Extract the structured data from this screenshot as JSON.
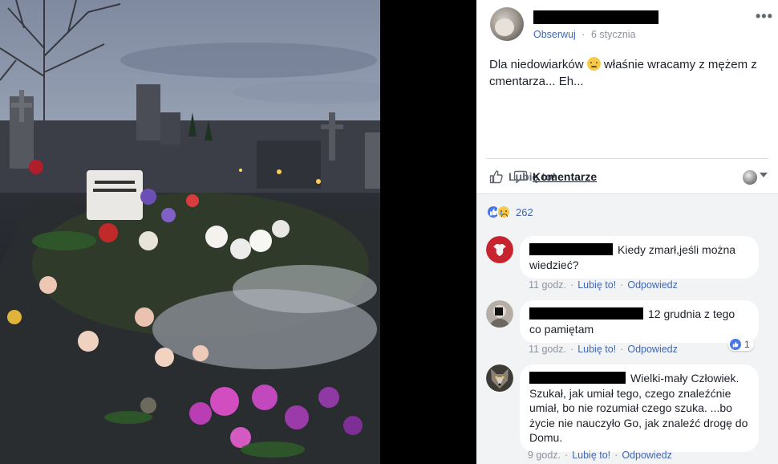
{
  "post": {
    "follow_label": "Obserwuj",
    "meta_separator": "·",
    "date": "6 stycznia",
    "more_label": "•••",
    "text_before_emoji": "Dla niedowiarków ",
    "text_after_emoji": " właśnie wracamy z mężem z cmentarza... Eh..."
  },
  "actions": {
    "like_label": "Lubię to!",
    "comment_label": "Komentarze"
  },
  "reactions": {
    "count": "262"
  },
  "comments": [
    {
      "text": "Kiedy zmarł,jeśli można wiedzieć?",
      "time": "11 godz.",
      "like_label": "Lubię to!",
      "reply_label": "Odpowiedz"
    },
    {
      "text": "12 grudnia z tego co pamiętam",
      "time": "11 godz.",
      "like_label": "Lubię to!",
      "reply_label": "Odpowiedz",
      "likes": "1"
    },
    {
      "text": "Wielki-mały Człowiek. Szukał, jak umiał tego, czego znaleźćnie umiał, bo nie rozumiał czego szuka. ...bo życie nie nauczyło Go, jak znaleźć drogę do Domu.",
      "time": "9 godz.",
      "like_label": "Lubię to!",
      "reply_label": "Odpowiedz"
    }
  ],
  "colors": {
    "link_blue": "#4267b2",
    "meta_gray": "#90949c",
    "comment_area": "#f2f3f5"
  }
}
